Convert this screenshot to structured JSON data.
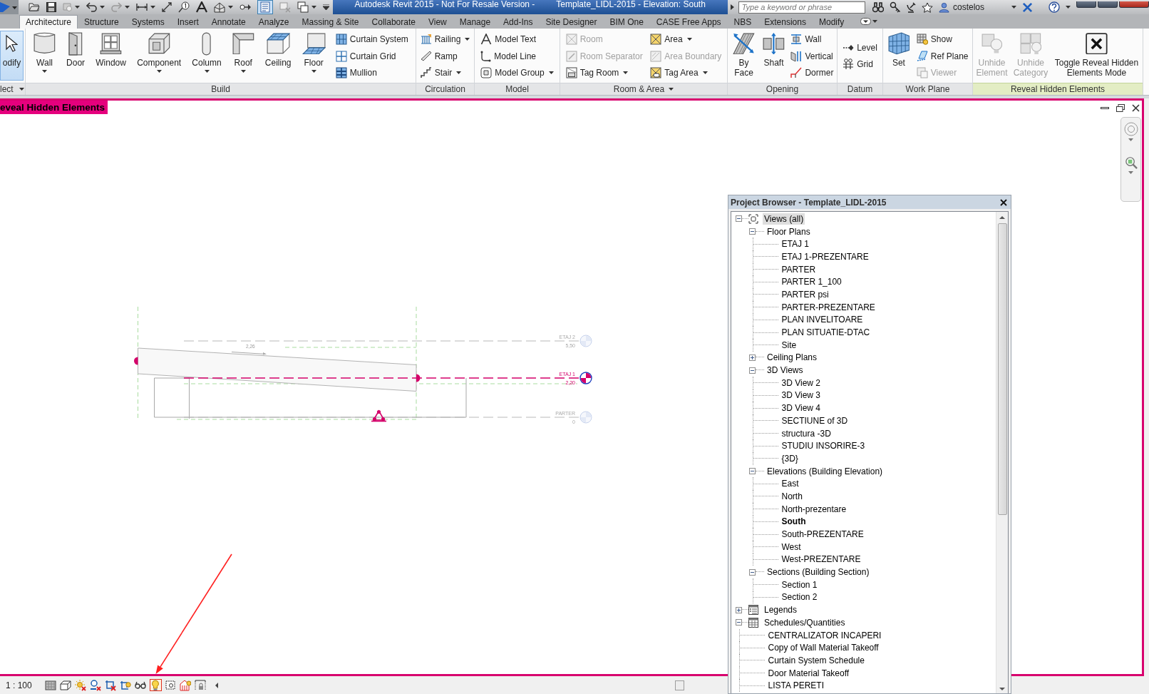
{
  "title_bar": {
    "thin_lines_selected": true,
    "title": "Autodesk Revit 2015 - Not For Resale Version -",
    "document": "Template_LIDL-2015 - Elevation: South",
    "search": {
      "placeholder": "Type a keyword or phrase"
    },
    "user": "costelos"
  },
  "ribbon": {
    "tabs": [
      {
        "label": "Architecture",
        "selected": true
      },
      {
        "label": "Structure",
        "selected": false
      },
      {
        "label": "Systems",
        "selected": false
      },
      {
        "label": "Insert",
        "selected": false
      },
      {
        "label": "Annotate",
        "selected": false
      },
      {
        "label": "Analyze",
        "selected": false
      },
      {
        "label": "Massing & Site",
        "selected": false
      },
      {
        "label": "Collaborate",
        "selected": false
      },
      {
        "label": "View",
        "selected": false
      },
      {
        "label": "Manage",
        "selected": false
      },
      {
        "label": "Add-Ins",
        "selected": false
      },
      {
        "label": "Site Designer",
        "selected": false
      },
      {
        "label": "BIM One",
        "selected": false
      },
      {
        "label": "CASE Free Apps",
        "selected": false
      },
      {
        "label": "NBS",
        "selected": false
      },
      {
        "label": "Extensions",
        "selected": false
      },
      {
        "label": "Modify",
        "selected": false
      }
    ],
    "panels": [
      {
        "label": "lect",
        "dropdown": true,
        "highlighted": false,
        "items": [
          {
            "kind": "large",
            "label": "odify",
            "dropdown": false,
            "disabled": false,
            "selected": true
          }
        ]
      },
      {
        "label": "Build",
        "dropdown": false,
        "highlighted": false,
        "items": [
          {
            "kind": "large",
            "label": "Wall",
            "dropdown": true,
            "disabled": false
          },
          {
            "kind": "large",
            "label": "Door",
            "dropdown": false,
            "disabled": false
          },
          {
            "kind": "large",
            "label": "Window",
            "dropdown": false,
            "disabled": false
          },
          {
            "kind": "large",
            "label": "Component",
            "dropdown": true,
            "disabled": false
          },
          {
            "kind": "large",
            "label": "Column",
            "dropdown": true,
            "disabled": false
          },
          {
            "kind": "large",
            "label": "Roof",
            "dropdown": true,
            "disabled": false
          },
          {
            "kind": "large",
            "label": "Ceiling",
            "dropdown": false,
            "disabled": false
          },
          {
            "kind": "large",
            "label": "Floor",
            "dropdown": true,
            "disabled": false
          },
          {
            "kind": "small",
            "label": "Curtain System",
            "dropdown": false,
            "disabled": false
          },
          {
            "kind": "small",
            "label": "Curtain Grid",
            "dropdown": false,
            "disabled": false
          },
          {
            "kind": "small",
            "label": "Mullion",
            "dropdown": false,
            "disabled": false
          }
        ]
      },
      {
        "label": "Circulation",
        "dropdown": false,
        "highlighted": false,
        "items": [
          {
            "kind": "small",
            "label": "Railing",
            "dropdown": true,
            "disabled": false
          },
          {
            "kind": "small",
            "label": "Ramp",
            "dropdown": false,
            "disabled": false
          },
          {
            "kind": "small",
            "label": "Stair",
            "dropdown": true,
            "disabled": false
          }
        ]
      },
      {
        "label": "Model",
        "dropdown": false,
        "highlighted": false,
        "items": [
          {
            "kind": "small",
            "label": "Model Text",
            "dropdown": false,
            "disabled": false
          },
          {
            "kind": "small",
            "label": "Model Line",
            "dropdown": false,
            "disabled": false
          },
          {
            "kind": "small",
            "label": "Model Group",
            "dropdown": true,
            "disabled": false
          }
        ]
      },
      {
        "label": "Room & Area",
        "dropdown": true,
        "highlighted": false,
        "items": [
          {
            "kind": "small",
            "label": "Room",
            "dropdown": false,
            "disabled": true
          },
          {
            "kind": "small",
            "label": "Room Separator",
            "dropdown": false,
            "disabled": true
          },
          {
            "kind": "small",
            "label": "Tag Room",
            "dropdown": true,
            "disabled": false
          },
          {
            "kind": "small",
            "label": "Area",
            "dropdown": true,
            "disabled": false
          },
          {
            "kind": "small",
            "label": "Area Boundary",
            "dropdown": false,
            "disabled": true
          },
          {
            "kind": "small",
            "label": "Tag Area",
            "dropdown": true,
            "disabled": false
          }
        ]
      },
      {
        "label": "Opening",
        "dropdown": false,
        "highlighted": false,
        "items": [
          {
            "kind": "large",
            "label": "By Face",
            "dropdown": false,
            "disabled": false
          },
          {
            "kind": "large",
            "label": "Shaft",
            "dropdown": false,
            "disabled": false
          },
          {
            "kind": "small",
            "label": "Wall",
            "dropdown": false,
            "disabled": false
          },
          {
            "kind": "small",
            "label": "Vertical",
            "dropdown": false,
            "disabled": false
          },
          {
            "kind": "small",
            "label": "Dormer",
            "dropdown": false,
            "disabled": false
          }
        ]
      },
      {
        "label": "Datum",
        "dropdown": false,
        "highlighted": false,
        "items": [
          {
            "kind": "small",
            "label": "Level",
            "dropdown": false,
            "disabled": false
          },
          {
            "kind": "small",
            "label": "Grid",
            "dropdown": false,
            "disabled": false
          }
        ]
      },
      {
        "label": "Work Plane",
        "dropdown": false,
        "highlighted": false,
        "items": [
          {
            "kind": "large",
            "label": "Set",
            "dropdown": false,
            "disabled": false
          },
          {
            "kind": "small",
            "label": "Show",
            "dropdown": false,
            "disabled": false
          },
          {
            "kind": "small",
            "label": "Ref Plane",
            "dropdown": false,
            "disabled": false
          },
          {
            "kind": "small",
            "label": "Viewer",
            "dropdown": false,
            "disabled": true
          }
        ]
      },
      {
        "label": "Reveal Hidden Elements",
        "dropdown": false,
        "highlighted": true,
        "items": [
          {
            "kind": "large",
            "label": "Unhide Element",
            "dropdown": false,
            "disabled": true
          },
          {
            "kind": "large",
            "label": "Unhide Category",
            "dropdown": false,
            "disabled": true
          },
          {
            "kind": "large",
            "label": "Toggle Reveal Hidden Elements Mode",
            "dropdown": false,
            "disabled": false
          }
        ]
      }
    ]
  },
  "view": {
    "banner": "eveal Hidden Elements",
    "slope_label": "2,26",
    "levels": [
      {
        "name": "ETAJ 2",
        "elevation": "5,50",
        "selected": false
      },
      {
        "name": "ETAJ 1",
        "elevation": "2,20",
        "selected": true
      },
      {
        "name": "PARTER",
        "elevation": "0",
        "selected": false
      }
    ]
  },
  "project_browser": {
    "title": "Project Browser - Template_LIDL-2015",
    "tree": [
      {
        "label": "Views (all)",
        "selected": true,
        "expanded": true,
        "children": [
          {
            "label": "Floor Plans",
            "selected": false,
            "expanded": true,
            "children": [
              {
                "label": "ETAJ 1",
                "selected": false,
                "current": false
              },
              {
                "label": "ETAJ 1-PREZENTARE",
                "selected": false,
                "current": false
              },
              {
                "label": "PARTER",
                "selected": false,
                "current": false
              },
              {
                "label": "PARTER 1_100",
                "selected": false,
                "current": false
              },
              {
                "label": "PARTER psi",
                "selected": false,
                "current": false
              },
              {
                "label": "PARTER-PREZENTARE",
                "selected": false,
                "current": false
              },
              {
                "label": "PLAN INVELITOARE",
                "selected": false,
                "current": false
              },
              {
                "label": "PLAN SITUATIE-DTAC",
                "selected": false,
                "current": false
              },
              {
                "label": "Site",
                "selected": false,
                "current": false
              }
            ]
          },
          {
            "label": "Ceiling Plans",
            "selected": false,
            "expanded": false
          },
          {
            "label": "3D Views",
            "selected": false,
            "expanded": true,
            "children": [
              {
                "label": "3D View 2",
                "selected": false,
                "current": false
              },
              {
                "label": "3D View 3",
                "selected": false,
                "current": false
              },
              {
                "label": "3D View 4",
                "selected": false,
                "current": false
              },
              {
                "label": "SECTIUNE of 3D",
                "selected": false,
                "current": false
              },
              {
                "label": "structura -3D",
                "selected": false,
                "current": false
              },
              {
                "label": "STUDIU INSORIRE-3",
                "selected": false,
                "current": false
              },
              {
                "label": "{3D}",
                "selected": false,
                "current": false
              }
            ]
          },
          {
            "label": "Elevations (Building Elevation)",
            "selected": false,
            "expanded": true,
            "children": [
              {
                "label": "East",
                "selected": false,
                "current": false
              },
              {
                "label": "North",
                "selected": false,
                "current": false
              },
              {
                "label": "North-prezentare",
                "selected": false,
                "current": false
              },
              {
                "label": "South",
                "selected": false,
                "current": true
              },
              {
                "label": "South-PREZENTARE",
                "selected": false,
                "current": false
              },
              {
                "label": "West",
                "selected": false,
                "current": false
              },
              {
                "label": "West-PREZENTARE",
                "selected": false,
                "current": false
              }
            ]
          },
          {
            "label": "Sections (Building Section)",
            "selected": false,
            "expanded": true,
            "children": [
              {
                "label": "Section 1",
                "selected": false,
                "current": false
              },
              {
                "label": "Section 2",
                "selected": false,
                "current": false
              }
            ]
          }
        ]
      },
      {
        "label": "Legends",
        "selected": false,
        "expanded": false
      },
      {
        "label": "Schedules/Quantities",
        "selected": false,
        "expanded": true,
        "children": [
          {
            "label": "CENTRALIZATOR INCAPERI",
            "selected": false,
            "current": false
          },
          {
            "label": "Copy of Wall Material Takeoff",
            "selected": false,
            "current": false
          },
          {
            "label": "Curtain System Schedule",
            "selected": false,
            "current": false
          },
          {
            "label": "Door Material Takeoff",
            "selected": false,
            "current": false
          },
          {
            "label": "LISTA PERETI",
            "selected": false,
            "current": false
          }
        ]
      }
    ]
  },
  "status_bar": {
    "scale": "1 : 100",
    "reveal_hidden_active": true
  }
}
